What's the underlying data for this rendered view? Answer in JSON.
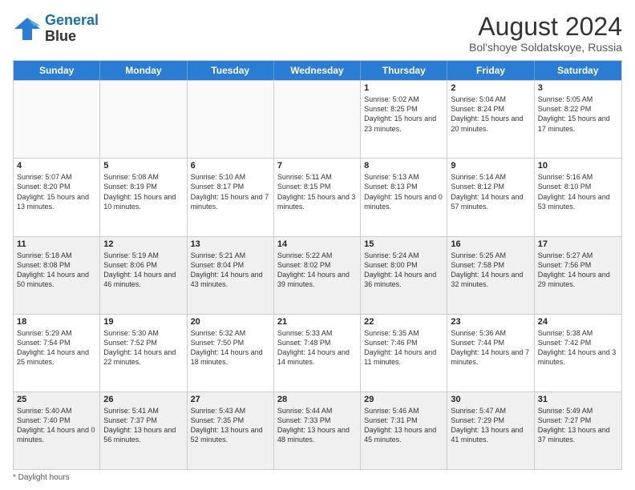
{
  "header": {
    "logo_line1": "General",
    "logo_line2": "Blue",
    "main_title": "August 2024",
    "sub_title": "Bol'shoye Soldatskoye, Russia"
  },
  "weekdays": [
    "Sunday",
    "Monday",
    "Tuesday",
    "Wednesday",
    "Thursday",
    "Friday",
    "Saturday"
  ],
  "rows": [
    [
      {
        "day": "",
        "text": "",
        "empty": true
      },
      {
        "day": "",
        "text": "",
        "empty": true
      },
      {
        "day": "",
        "text": "",
        "empty": true
      },
      {
        "day": "",
        "text": "",
        "empty": true
      },
      {
        "day": "1",
        "text": "Sunrise: 5:02 AM\nSunset: 8:25 PM\nDaylight: 15 hours\nand 23 minutes."
      },
      {
        "day": "2",
        "text": "Sunrise: 5:04 AM\nSunset: 8:24 PM\nDaylight: 15 hours\nand 20 minutes."
      },
      {
        "day": "3",
        "text": "Sunrise: 5:05 AM\nSunset: 8:22 PM\nDaylight: 15 hours\nand 17 minutes."
      }
    ],
    [
      {
        "day": "4",
        "text": "Sunrise: 5:07 AM\nSunset: 8:20 PM\nDaylight: 15 hours\nand 13 minutes."
      },
      {
        "day": "5",
        "text": "Sunrise: 5:08 AM\nSunset: 8:19 PM\nDaylight: 15 hours\nand 10 minutes."
      },
      {
        "day": "6",
        "text": "Sunrise: 5:10 AM\nSunset: 8:17 PM\nDaylight: 15 hours\nand 7 minutes."
      },
      {
        "day": "7",
        "text": "Sunrise: 5:11 AM\nSunset: 8:15 PM\nDaylight: 15 hours\nand 3 minutes."
      },
      {
        "day": "8",
        "text": "Sunrise: 5:13 AM\nSunset: 8:13 PM\nDaylight: 15 hours\nand 0 minutes."
      },
      {
        "day": "9",
        "text": "Sunrise: 5:14 AM\nSunset: 8:12 PM\nDaylight: 14 hours\nand 57 minutes."
      },
      {
        "day": "10",
        "text": "Sunrise: 5:16 AM\nSunset: 8:10 PM\nDaylight: 14 hours\nand 53 minutes."
      }
    ],
    [
      {
        "day": "11",
        "text": "Sunrise: 5:18 AM\nSunset: 8:08 PM\nDaylight: 14 hours\nand 50 minutes.",
        "shaded": true
      },
      {
        "day": "12",
        "text": "Sunrise: 5:19 AM\nSunset: 8:06 PM\nDaylight: 14 hours\nand 46 minutes.",
        "shaded": true
      },
      {
        "day": "13",
        "text": "Sunrise: 5:21 AM\nSunset: 8:04 PM\nDaylight: 14 hours\nand 43 minutes.",
        "shaded": true
      },
      {
        "day": "14",
        "text": "Sunrise: 5:22 AM\nSunset: 8:02 PM\nDaylight: 14 hours\nand 39 minutes.",
        "shaded": true
      },
      {
        "day": "15",
        "text": "Sunrise: 5:24 AM\nSunset: 8:00 PM\nDaylight: 14 hours\nand 36 minutes.",
        "shaded": true
      },
      {
        "day": "16",
        "text": "Sunrise: 5:25 AM\nSunset: 7:58 PM\nDaylight: 14 hours\nand 32 minutes.",
        "shaded": true
      },
      {
        "day": "17",
        "text": "Sunrise: 5:27 AM\nSunset: 7:56 PM\nDaylight: 14 hours\nand 29 minutes.",
        "shaded": true
      }
    ],
    [
      {
        "day": "18",
        "text": "Sunrise: 5:29 AM\nSunset: 7:54 PM\nDaylight: 14 hours\nand 25 minutes."
      },
      {
        "day": "19",
        "text": "Sunrise: 5:30 AM\nSunset: 7:52 PM\nDaylight: 14 hours\nand 22 minutes."
      },
      {
        "day": "20",
        "text": "Sunrise: 5:32 AM\nSunset: 7:50 PM\nDaylight: 14 hours\nand 18 minutes."
      },
      {
        "day": "21",
        "text": "Sunrise: 5:33 AM\nSunset: 7:48 PM\nDaylight: 14 hours\nand 14 minutes."
      },
      {
        "day": "22",
        "text": "Sunrise: 5:35 AM\nSunset: 7:46 PM\nDaylight: 14 hours\nand 11 minutes."
      },
      {
        "day": "23",
        "text": "Sunrise: 5:36 AM\nSunset: 7:44 PM\nDaylight: 14 hours\nand 7 minutes."
      },
      {
        "day": "24",
        "text": "Sunrise: 5:38 AM\nSunset: 7:42 PM\nDaylight: 14 hours\nand 3 minutes."
      }
    ],
    [
      {
        "day": "25",
        "text": "Sunrise: 5:40 AM\nSunset: 7:40 PM\nDaylight: 14 hours\nand 0 minutes.",
        "shaded": true
      },
      {
        "day": "26",
        "text": "Sunrise: 5:41 AM\nSunset: 7:37 PM\nDaylight: 13 hours\nand 56 minutes.",
        "shaded": true
      },
      {
        "day": "27",
        "text": "Sunrise: 5:43 AM\nSunset: 7:35 PM\nDaylight: 13 hours\nand 52 minutes.",
        "shaded": true
      },
      {
        "day": "28",
        "text": "Sunrise: 5:44 AM\nSunset: 7:33 PM\nDaylight: 13 hours\nand 48 minutes.",
        "shaded": true
      },
      {
        "day": "29",
        "text": "Sunrise: 5:46 AM\nSunset: 7:31 PM\nDaylight: 13 hours\nand 45 minutes.",
        "shaded": true
      },
      {
        "day": "30",
        "text": "Sunrise: 5:47 AM\nSunset: 7:29 PM\nDaylight: 13 hours\nand 41 minutes.",
        "shaded": true
      },
      {
        "day": "31",
        "text": "Sunrise: 5:49 AM\nSunset: 7:27 PM\nDaylight: 13 hours\nand 37 minutes.",
        "shaded": true
      }
    ]
  ],
  "footer": "Daylight hours"
}
